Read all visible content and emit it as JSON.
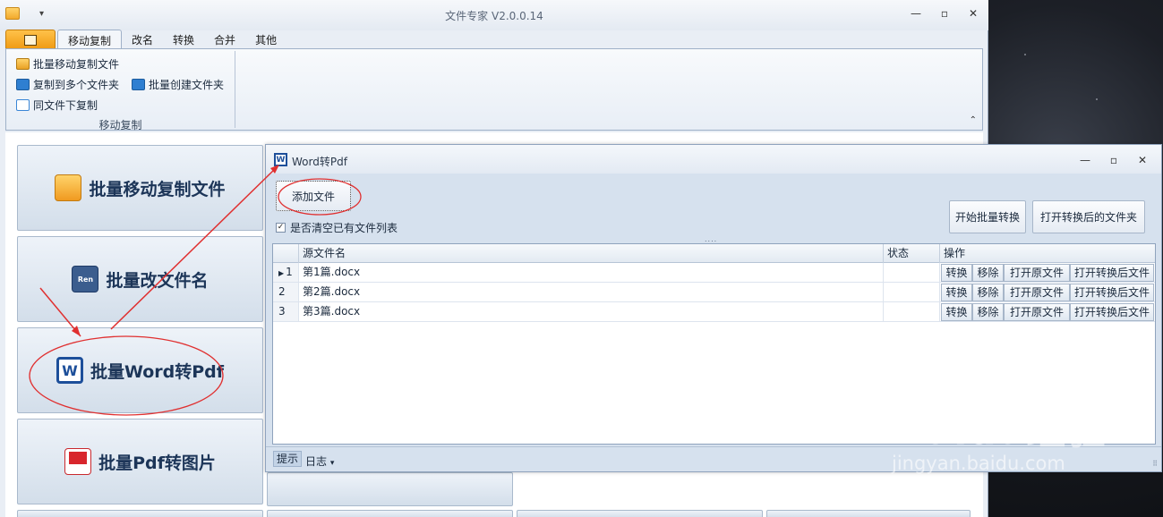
{
  "window": {
    "title": "文件专家 V2.0.0.14",
    "qat_glyph": "▾",
    "controls": [
      "—",
      "▫",
      "✕"
    ]
  },
  "ribbon": {
    "tabs": [
      "移动复制",
      "改名",
      "转换",
      "合并",
      "其他"
    ],
    "active_tab": "移动复制",
    "items": {
      "batch_move_copy": "批量移动复制文件",
      "copy_to_multi": "复制到多个文件夹",
      "batch_create_folder": "批量创建文件夹",
      "copy_same_folder": "同文件下复制"
    },
    "group_label": "移动复制",
    "collapse_glyph": "⌃"
  },
  "big_buttons": [
    {
      "label": "批量移动复制文件",
      "icon": "folder-icon"
    },
    {
      "label": "批量改文件名",
      "icon": "ren-icon",
      "icon_text": "Ren"
    },
    {
      "label": "批量Word转Pdf",
      "icon": "word-icon",
      "icon_text": "W"
    },
    {
      "label": "批量Pdf转图片",
      "icon": "pdf-icon"
    }
  ],
  "child_window": {
    "title": "Word转Pdf",
    "icon_text": "W",
    "controls": [
      "—",
      "▫",
      "✕"
    ],
    "add_file_button": "添加文件",
    "clear_list_checkbox": {
      "label": "是否清空已有文件列表",
      "checked": true,
      "check_glyph": "✓"
    },
    "start_button": "开始批量转换",
    "open_output_button": "打开转换后的文件夹",
    "splitter_glyph": "....",
    "grid": {
      "columns": [
        "源文件名",
        "状态",
        "操作"
      ],
      "current_row_glyph": "▶",
      "rows": [
        {
          "index": "1",
          "file": "第1篇.docx",
          "status": "",
          "current": true
        },
        {
          "index": "2",
          "file": "第2篇.docx",
          "status": "",
          "current": false
        },
        {
          "index": "3",
          "file": "第3篇.docx",
          "status": "",
          "current": false
        }
      ],
      "row_actions": [
        "转换",
        "移除",
        "打开原文件",
        "打开转换后文件"
      ]
    },
    "statusbar": {
      "tip_tab": "提示",
      "log_tab": "日志",
      "dropdown_glyph": "▾",
      "grip_glyph": "⠿"
    }
  },
  "watermark": {
    "main": "Baidu经验",
    "sub": "jingyan.baidu.com"
  },
  "colors": {
    "annotation_red": "#e03030",
    "accent_blue": "#1d4f9a",
    "file_tab_orange": "#ef9a12"
  }
}
